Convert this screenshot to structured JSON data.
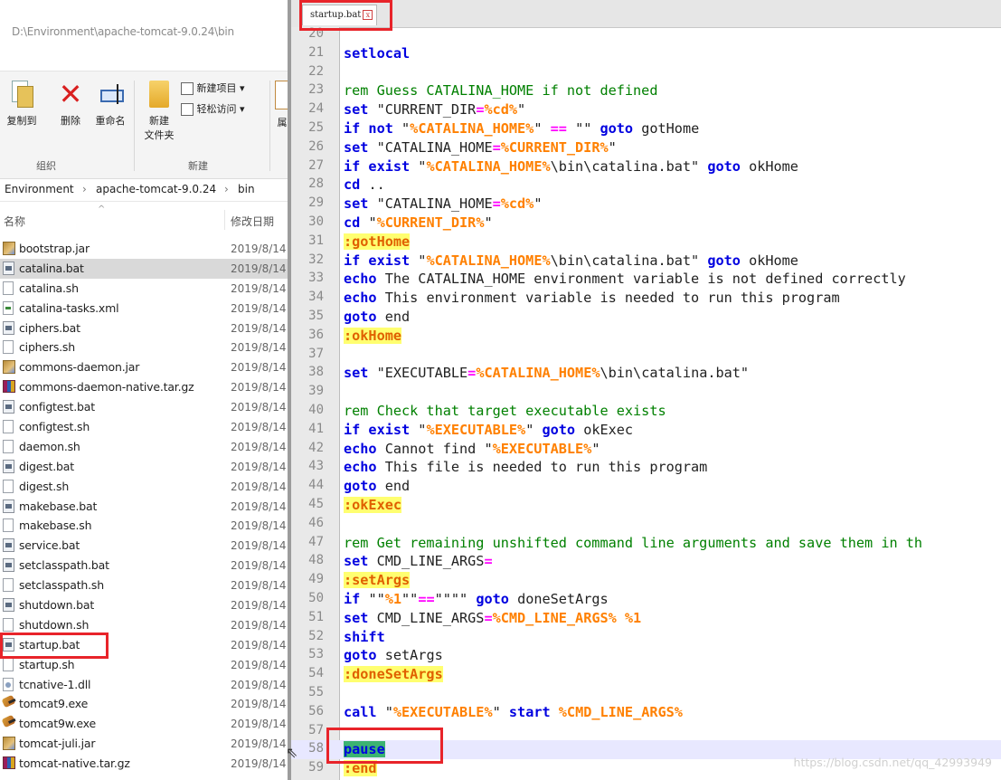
{
  "explorer": {
    "address_path": "D:\\Environment\\apache-tomcat-9.0.24\\bin",
    "ribbon": {
      "copy_to": "复制到",
      "delete": "删除",
      "rename": "重命名",
      "new_folder_line1": "新建",
      "new_folder_line2": "文件夹",
      "new_item": "新建项目 ▾",
      "easy_access": "轻松访问 ▾",
      "more": "属",
      "group_organize": "组织",
      "group_new": "新建"
    },
    "breadcrumb": {
      "part1": "Environment",
      "sep": "›",
      "part2": "apache-tomcat-9.0.24",
      "part3": "bin"
    },
    "columns": {
      "name": "名称",
      "date": "修改日期"
    },
    "files": [
      {
        "name": "bootstrap.jar",
        "date": "2019/8/14",
        "icon": "jar"
      },
      {
        "name": "catalina.bat",
        "date": "2019/8/14",
        "icon": "bat",
        "selected": true
      },
      {
        "name": "catalina.sh",
        "date": "2019/8/14",
        "icon": "doc"
      },
      {
        "name": "catalina-tasks.xml",
        "date": "2019/8/14",
        "icon": "xml"
      },
      {
        "name": "ciphers.bat",
        "date": "2019/8/14",
        "icon": "bat"
      },
      {
        "name": "ciphers.sh",
        "date": "2019/8/14",
        "icon": "doc"
      },
      {
        "name": "commons-daemon.jar",
        "date": "2019/8/14",
        "icon": "jar"
      },
      {
        "name": "commons-daemon-native.tar.gz",
        "date": "2019/8/14",
        "icon": "gz"
      },
      {
        "name": "configtest.bat",
        "date": "2019/8/14",
        "icon": "bat"
      },
      {
        "name": "configtest.sh",
        "date": "2019/8/14",
        "icon": "doc"
      },
      {
        "name": "daemon.sh",
        "date": "2019/8/14",
        "icon": "doc"
      },
      {
        "name": "digest.bat",
        "date": "2019/8/14",
        "icon": "bat"
      },
      {
        "name": "digest.sh",
        "date": "2019/8/14",
        "icon": "doc"
      },
      {
        "name": "makebase.bat",
        "date": "2019/8/14",
        "icon": "bat"
      },
      {
        "name": "makebase.sh",
        "date": "2019/8/14",
        "icon": "doc"
      },
      {
        "name": "service.bat",
        "date": "2019/8/14",
        "icon": "bat"
      },
      {
        "name": "setclasspath.bat",
        "date": "2019/8/14",
        "icon": "bat"
      },
      {
        "name": "setclasspath.sh",
        "date": "2019/8/14",
        "icon": "doc"
      },
      {
        "name": "shutdown.bat",
        "date": "2019/8/14",
        "icon": "bat"
      },
      {
        "name": "shutdown.sh",
        "date": "2019/8/14",
        "icon": "doc"
      },
      {
        "name": "startup.bat",
        "date": "2019/8/14",
        "icon": "bat"
      },
      {
        "name": "startup.sh",
        "date": "2019/8/14",
        "icon": "doc"
      },
      {
        "name": "tcnative-1.dll",
        "date": "2019/8/14",
        "icon": "dll"
      },
      {
        "name": "tomcat9.exe",
        "date": "2019/8/14",
        "icon": "exe"
      },
      {
        "name": "tomcat9w.exe",
        "date": "2019/8/14",
        "icon": "exe"
      },
      {
        "name": "tomcat-juli.jar",
        "date": "2019/8/14",
        "icon": "jar"
      },
      {
        "name": "tomcat-native.tar.gz",
        "date": "2019/8/14",
        "icon": "gz"
      }
    ]
  },
  "editor": {
    "tab_label": "startup.bat",
    "tab_close": "x",
    "current_line": 58,
    "lines": [
      {
        "n": "20",
        "t": [
          [
            "pl",
            ""
          ]
        ]
      },
      {
        "n": "21",
        "t": [
          [
            "kw",
            "setlocal"
          ]
        ]
      },
      {
        "n": "22",
        "t": [
          [
            "pl",
            ""
          ]
        ]
      },
      {
        "n": "23",
        "t": [
          [
            "cm",
            "rem Guess CATALINA_HOME if not defined"
          ]
        ]
      },
      {
        "n": "24",
        "t": [
          [
            "kw",
            "set"
          ],
          [
            "pl",
            " \"CURRENT_DIR"
          ],
          [
            "op",
            "="
          ],
          [
            "vr",
            "%cd%"
          ],
          [
            "pl",
            "\""
          ]
        ]
      },
      {
        "n": "25",
        "t": [
          [
            "kw",
            "if not"
          ],
          [
            "pl",
            " \""
          ],
          [
            "vr",
            "%CATALINA_HOME%"
          ],
          [
            "pl",
            "\" "
          ],
          [
            "op",
            "=="
          ],
          [
            "pl",
            " \"\" "
          ],
          [
            "kw",
            "goto"
          ],
          [
            "pl",
            " gotHome"
          ]
        ]
      },
      {
        "n": "26",
        "t": [
          [
            "kw",
            "set"
          ],
          [
            "pl",
            " \"CATALINA_HOME"
          ],
          [
            "op",
            "="
          ],
          [
            "vr",
            "%CURRENT_DIR%"
          ],
          [
            "pl",
            "\""
          ]
        ]
      },
      {
        "n": "27",
        "t": [
          [
            "kw",
            "if exist"
          ],
          [
            "pl",
            " \""
          ],
          [
            "vr",
            "%CATALINA_HOME%"
          ],
          [
            "pl",
            "\\bin\\catalina.bat\" "
          ],
          [
            "kw",
            "goto"
          ],
          [
            "pl",
            " okHome"
          ]
        ]
      },
      {
        "n": "28",
        "t": [
          [
            "kw",
            "cd"
          ],
          [
            "pl",
            " .."
          ]
        ]
      },
      {
        "n": "29",
        "t": [
          [
            "kw",
            "set"
          ],
          [
            "pl",
            " \"CATALINA_HOME"
          ],
          [
            "op",
            "="
          ],
          [
            "vr",
            "%cd%"
          ],
          [
            "pl",
            "\""
          ]
        ]
      },
      {
        "n": "30",
        "t": [
          [
            "kw",
            "cd"
          ],
          [
            "pl",
            " \""
          ],
          [
            "vr",
            "%CURRENT_DIR%"
          ],
          [
            "pl",
            "\""
          ]
        ]
      },
      {
        "n": "31",
        "t": [
          [
            "lb",
            ":gotHome"
          ]
        ]
      },
      {
        "n": "32",
        "t": [
          [
            "kw",
            "if exist"
          ],
          [
            "pl",
            " \""
          ],
          [
            "vr",
            "%CATALINA_HOME%"
          ],
          [
            "pl",
            "\\bin\\catalina.bat\" "
          ],
          [
            "kw",
            "goto"
          ],
          [
            "pl",
            " okHome"
          ]
        ]
      },
      {
        "n": "33",
        "t": [
          [
            "kw",
            "echo"
          ],
          [
            "pl",
            " The CATALINA_HOME environment variable is not defined correctly"
          ]
        ]
      },
      {
        "n": "34",
        "t": [
          [
            "kw",
            "echo"
          ],
          [
            "pl",
            " This environment variable is needed to run this program"
          ]
        ]
      },
      {
        "n": "35",
        "t": [
          [
            "kw",
            "goto"
          ],
          [
            "pl",
            " end"
          ]
        ]
      },
      {
        "n": "36",
        "t": [
          [
            "lb",
            ":okHome"
          ]
        ]
      },
      {
        "n": "37",
        "t": [
          [
            "pl",
            ""
          ]
        ]
      },
      {
        "n": "38",
        "t": [
          [
            "kw",
            "set"
          ],
          [
            "pl",
            " \"EXECUTABLE"
          ],
          [
            "op",
            "="
          ],
          [
            "vr",
            "%CATALINA_HOME%"
          ],
          [
            "pl",
            "\\bin\\catalina.bat\""
          ]
        ]
      },
      {
        "n": "39",
        "t": [
          [
            "pl",
            ""
          ]
        ]
      },
      {
        "n": "40",
        "t": [
          [
            "cm",
            "rem Check that target executable exists"
          ]
        ]
      },
      {
        "n": "41",
        "t": [
          [
            "kw",
            "if exist"
          ],
          [
            "pl",
            " \""
          ],
          [
            "vr",
            "%EXECUTABLE%"
          ],
          [
            "pl",
            "\" "
          ],
          [
            "kw",
            "goto"
          ],
          [
            "pl",
            " okExec"
          ]
        ]
      },
      {
        "n": "42",
        "t": [
          [
            "kw",
            "echo"
          ],
          [
            "pl",
            " Cannot find \""
          ],
          [
            "vr",
            "%EXECUTABLE%"
          ],
          [
            "pl",
            "\""
          ]
        ]
      },
      {
        "n": "43",
        "t": [
          [
            "kw",
            "echo"
          ],
          [
            "pl",
            " This file is needed to run this program"
          ]
        ]
      },
      {
        "n": "44",
        "t": [
          [
            "kw",
            "goto"
          ],
          [
            "pl",
            " end"
          ]
        ]
      },
      {
        "n": "45",
        "t": [
          [
            "lb",
            ":okExec"
          ]
        ]
      },
      {
        "n": "46",
        "t": [
          [
            "pl",
            ""
          ]
        ]
      },
      {
        "n": "47",
        "t": [
          [
            "cm",
            "rem Get remaining unshifted command line arguments and save them in th"
          ]
        ]
      },
      {
        "n": "48",
        "t": [
          [
            "kw",
            "set"
          ],
          [
            "pl",
            " CMD_LINE_ARGS"
          ],
          [
            "op",
            "="
          ]
        ]
      },
      {
        "n": "49",
        "t": [
          [
            "lb",
            ":setArgs"
          ]
        ]
      },
      {
        "n": "50",
        "t": [
          [
            "kw",
            "if"
          ],
          [
            "pl",
            " \"\""
          ],
          [
            "vr",
            "%1"
          ],
          [
            "pl",
            "\"\""
          ],
          [
            "op",
            "=="
          ],
          [
            "pl",
            "\"\"\"\" "
          ],
          [
            "kw",
            "goto"
          ],
          [
            "pl",
            " doneSetArgs"
          ]
        ]
      },
      {
        "n": "51",
        "t": [
          [
            "kw",
            "set"
          ],
          [
            "pl",
            " CMD_LINE_ARGS"
          ],
          [
            "op",
            "="
          ],
          [
            "vr",
            "%CMD_LINE_ARGS% %1"
          ]
        ]
      },
      {
        "n": "52",
        "t": [
          [
            "kw",
            "shift"
          ]
        ]
      },
      {
        "n": "53",
        "t": [
          [
            "kw",
            "goto"
          ],
          [
            "pl",
            " setArgs"
          ]
        ]
      },
      {
        "n": "54",
        "t": [
          [
            "lb",
            ":doneSetArgs"
          ]
        ]
      },
      {
        "n": "55",
        "t": [
          [
            "pl",
            ""
          ]
        ]
      },
      {
        "n": "56",
        "t": [
          [
            "kw",
            "call"
          ],
          [
            "pl",
            " \""
          ],
          [
            "vr",
            "%EXECUTABLE%"
          ],
          [
            "pl",
            "\" "
          ],
          [
            "kw",
            "start"
          ],
          [
            "pl",
            " "
          ],
          [
            "vr",
            "%CMD_LINE_ARGS%"
          ]
        ]
      },
      {
        "n": "57",
        "t": [
          [
            "pl",
            ""
          ]
        ]
      },
      {
        "n": "58",
        "t": [
          [
            "pause",
            "pause"
          ]
        ]
      },
      {
        "n": "59",
        "t": [
          [
            "lb",
            ":end"
          ]
        ]
      }
    ]
  },
  "watermark": "https://blog.csdn.net/qq_42993949",
  "highlight_color": "#e8242a"
}
